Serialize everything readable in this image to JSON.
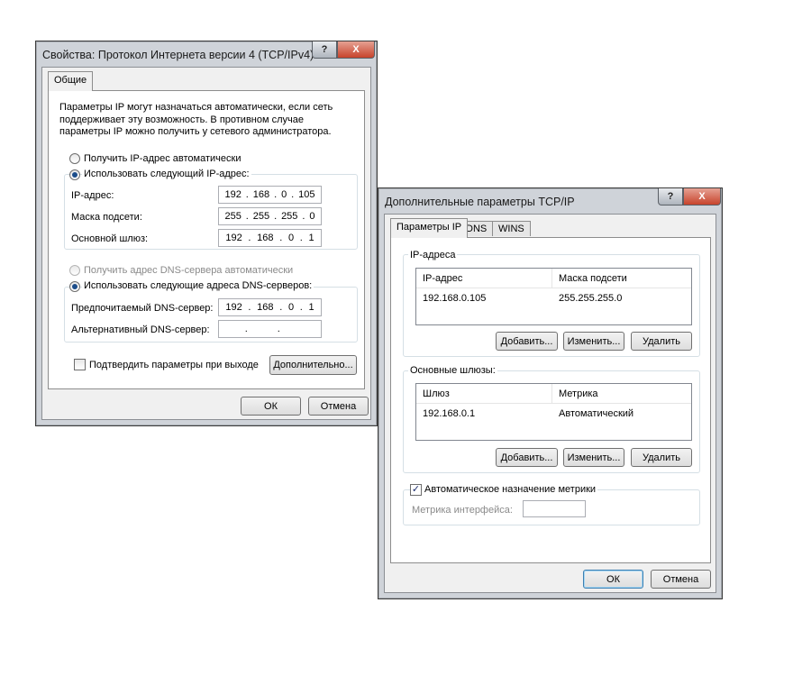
{
  "win1": {
    "title": "Свойства: Протокол Интернета версии 4 (TCP/IPv4)",
    "tab_general": "Общие",
    "description": "Параметры IP могут назначаться автоматически, если сеть поддерживает эту возможность. В противном случае параметры IP можно получить у сетевого администратора.",
    "radio_ip_auto": "Получить IP-адрес автоматически",
    "radio_ip_manual": "Использовать следующий IP-адрес:",
    "ip_label": "IP-адрес:",
    "mask_label": "Маска подсети:",
    "gateway_label": "Основной шлюз:",
    "ip": [
      "192",
      "168",
      "0",
      "105"
    ],
    "mask": [
      "255",
      "255",
      "255",
      "0"
    ],
    "gateway": [
      "192",
      "168",
      "0",
      "1"
    ],
    "radio_dns_auto": "Получить адрес DNS-сервера автоматически",
    "radio_dns_manual": "Использовать следующие адреса DNS-серверов:",
    "dns_pref_label": "Предпочитаемый DNS-сервер:",
    "dns_alt_label": "Альтернативный DNS-сервер:",
    "dns_pref": [
      "192",
      "168",
      "0",
      "1"
    ],
    "dns_alt": [
      "",
      "",
      "",
      ""
    ],
    "validate_checkbox": "Подтвердить параметры при выходе",
    "advanced_button": "Дополнительно...",
    "ok_button": "ОК",
    "cancel_button": "Отмена"
  },
  "win2": {
    "title": "Дополнительные параметры TCP/IP",
    "tabs": [
      "Параметры IP",
      "DNS",
      "WINS"
    ],
    "ip_group_label": "IP-адреса",
    "ip_columns": [
      "IP-адрес",
      "Маска подсети"
    ],
    "ip_rows": [
      [
        "192.168.0.105",
        "255.255.255.0"
      ]
    ],
    "gateway_group_label": "Основные шлюзы:",
    "gateway_columns": [
      "Шлюз",
      "Метрика"
    ],
    "gateway_rows": [
      [
        "192.168.0.1",
        "Автоматический"
      ]
    ],
    "add_button": "Добавить...",
    "edit_button": "Изменить...",
    "remove_button": "Удалить",
    "auto_metric_checkbox": "Автоматическое назначение метрики",
    "interface_metric_label": "Метрика интерфейса:",
    "interface_metric_value": "",
    "ok_button": "ОК",
    "cancel_button": "Отмена"
  },
  "title_buttons": {
    "help": "?",
    "close": "X"
  }
}
